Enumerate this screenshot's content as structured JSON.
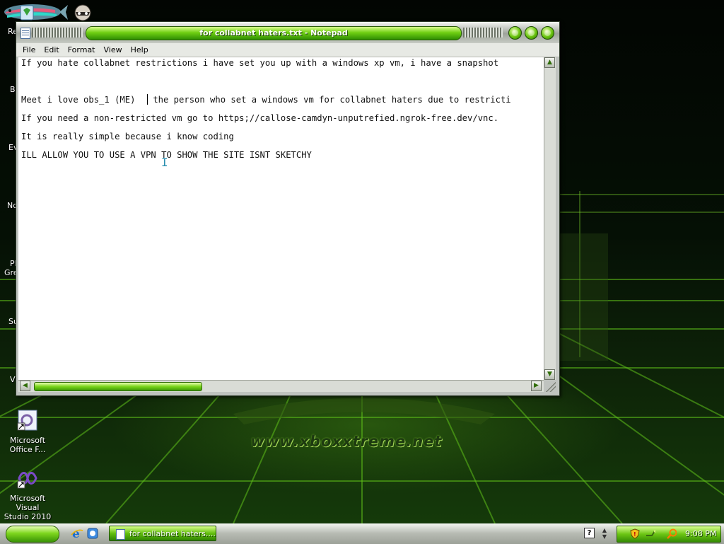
{
  "window": {
    "title": "for collabnet haters.txt - Notepad",
    "menu": [
      "File",
      "Edit",
      "Format",
      "View",
      "Help"
    ]
  },
  "document": {
    "lines": [
      "If you hate collabnet restrictions i have set you up with a windows xp vm, i have a snapshot",
      "Meet i love obs_1 (ME)",
      " the person who set a windows vm for collabnet haters due to restricti",
      "If you need a non-restricted vm go to https;//callose-camdyn-unputrefied.ngrok-free.dev/vnc.",
      "It is really simple because i know coding",
      "ILL ALLOW YOU TO USE A VPN TO SHOW THE SITE ISNT SKETCHY"
    ]
  },
  "desktop": {
    "edge_labels": [
      "Re",
      "Bi",
      "Ev",
      "No",
      "Pl",
      "Gre",
      "Su",
      "Vi"
    ],
    "icons": [
      {
        "label_1": "Microsoft",
        "label_2": "Office F..."
      },
      {
        "label_1": "Microsoft Visual",
        "label_2": "Studio 2010"
      }
    ],
    "wallpaper_text": "www.xboxxtreme.net"
  },
  "taskbar": {
    "task_label": "for collabnet haters....",
    "clock": "9:08 PM"
  },
  "colors": {
    "accent_green": "#6fcf12",
    "window_frame": "#bfc3bf",
    "editor_bg": "#ffffff"
  },
  "icons": {
    "recycle_bin": "recycle-bin-icon",
    "raccoon": "raccoon-icon",
    "office": "office-icon",
    "visual_studio": "visual-studio-icon",
    "quick_launch": [
      "ie-icon",
      "show-desktop-icon"
    ],
    "tray": [
      "shield-icon",
      "network-icon",
      "search-icon"
    ]
  }
}
